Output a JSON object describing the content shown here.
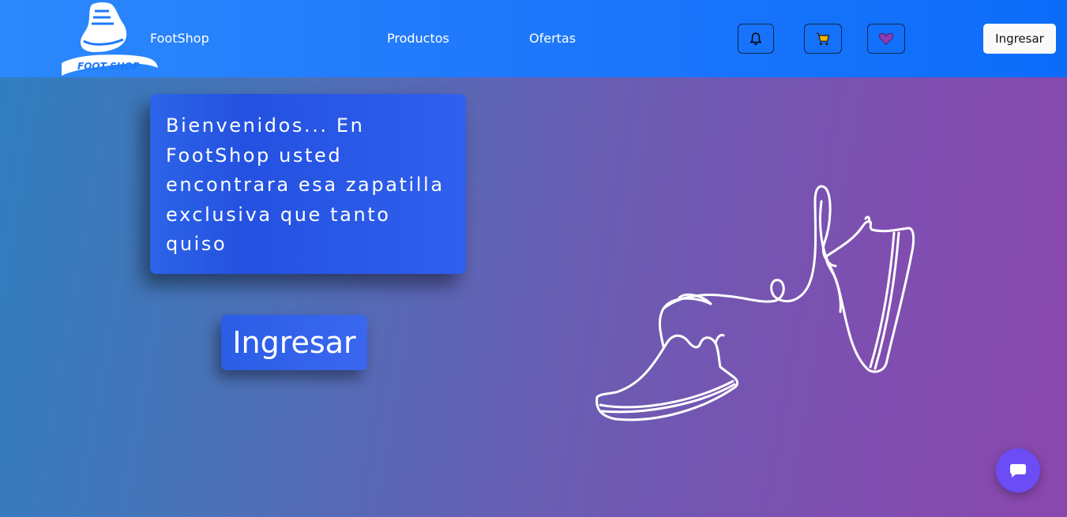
{
  "navbar": {
    "logo_text": "FOOT SHOP",
    "brand": "FootShop",
    "links": [
      "Productos",
      "Ofertas"
    ],
    "icons": [
      "bell-icon",
      "cart-icon",
      "heart-icon"
    ],
    "login_label": "Ingresar"
  },
  "hero": {
    "welcome": "Bienvenidos... En FootShop usted encontrara esa zapatilla exclusiva que tanto quiso",
    "cta_label": "Ingresar"
  },
  "chat": {
    "icon": "chat-icon"
  },
  "colors": {
    "nav": "#1e78fb",
    "card": "#2c5be6",
    "heart": "#8e3cb0",
    "chat": "#6c4cf5"
  }
}
